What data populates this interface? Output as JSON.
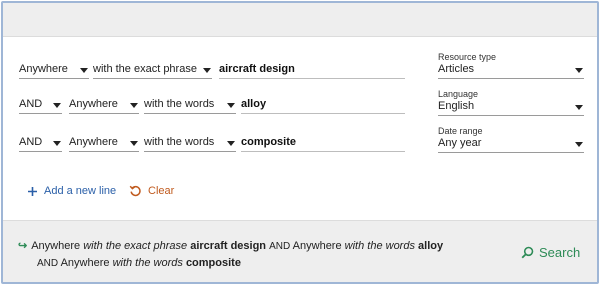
{
  "rows": [
    {
      "op": "",
      "field": "Anywhere",
      "qualifier": "with the exact phrase",
      "term": "aircraft design"
    },
    {
      "op": "AND",
      "field": "Anywhere",
      "qualifier": "with the words",
      "term": "alloy"
    },
    {
      "op": "AND",
      "field": "Anywhere",
      "qualifier": "with the words",
      "term": "composite"
    }
  ],
  "filters": {
    "resource_type": {
      "label": "Resource type",
      "value": "Articles"
    },
    "language": {
      "label": "Language",
      "value": "English"
    },
    "date_range": {
      "label": "Date range",
      "value": "Any year"
    }
  },
  "actions": {
    "add_line": "Add a new line",
    "clear": "Clear"
  },
  "summary": {
    "line1": [
      {
        "text": "Anywhere",
        "style": "n"
      },
      {
        "text": "with the exact phrase",
        "style": "it"
      },
      {
        "text": "aircraft design",
        "style": "b"
      },
      {
        "text": "AND",
        "style": "op"
      },
      {
        "text": "Anywhere",
        "style": "n"
      },
      {
        "text": "with the words",
        "style": "it"
      },
      {
        "text": "alloy",
        "style": "b"
      }
    ],
    "line2": [
      {
        "text": "AND",
        "style": "op"
      },
      {
        "text": "Anywhere",
        "style": "n"
      },
      {
        "text": "with the words",
        "style": "it"
      },
      {
        "text": "composite",
        "style": "b"
      }
    ]
  },
  "search_label": "Search",
  "colors": {
    "link_blue": "#2a5fa8",
    "clear_orange": "#c05a1e",
    "search_green": "#2e8b57",
    "frame_border": "#9fb6d6"
  },
  "icons": {
    "add": "plus-icon",
    "clear": "undo-icon",
    "search": "search-icon",
    "summary": "arrow-right-icon",
    "dropdown": "caret-down-icon"
  }
}
